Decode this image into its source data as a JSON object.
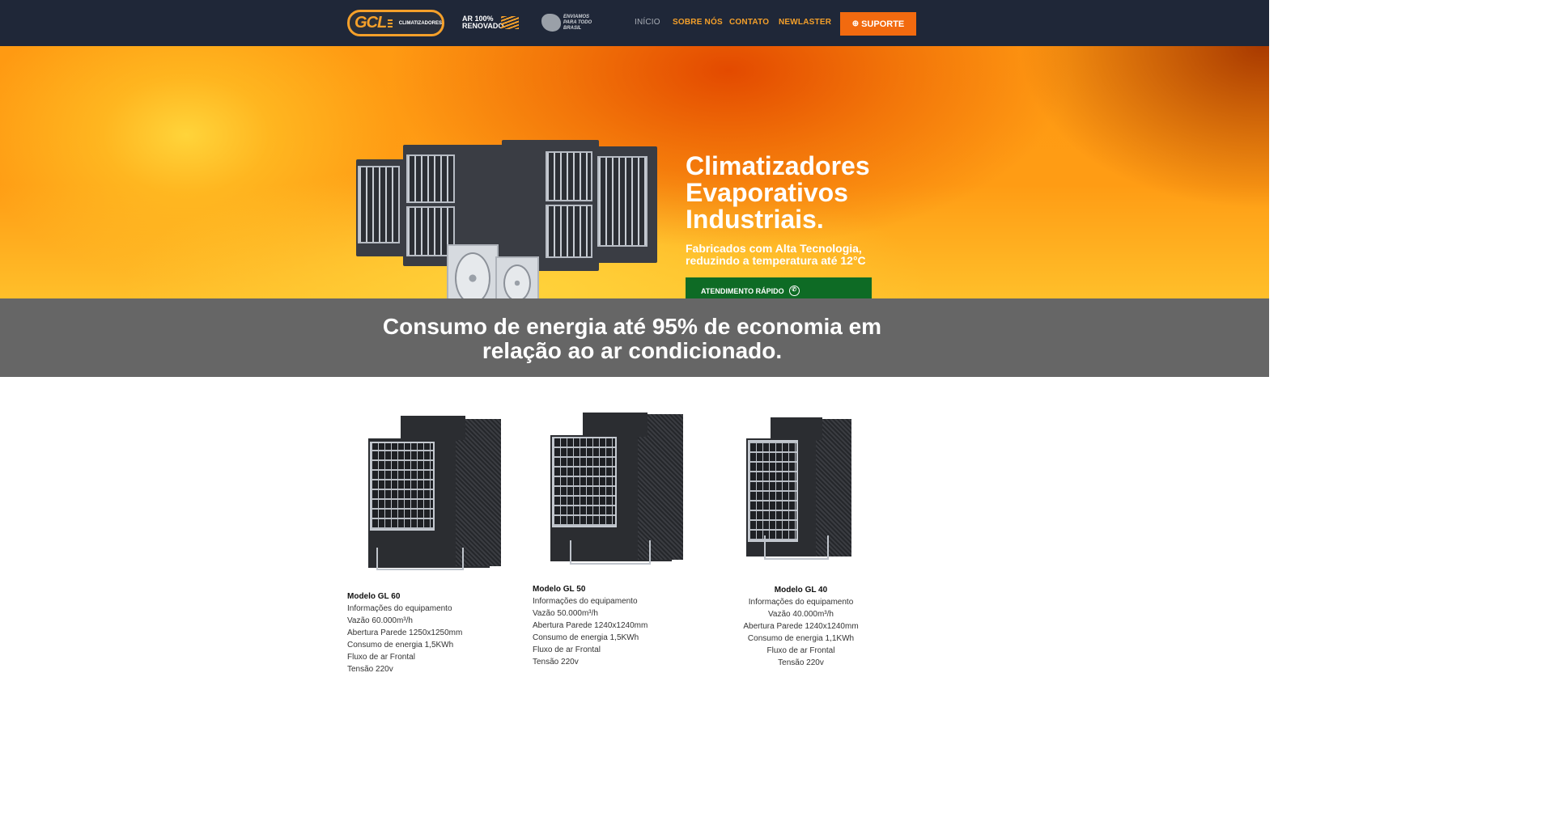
{
  "nav": {
    "logo_text": "GCL",
    "logo_sub": "CLIMATIZADORES",
    "badge_air": "AR 100% RENOVADO",
    "badge_br": "ENVIAMOS PARA TODO BRASIL",
    "menu": [
      "INÍCIO",
      "SOBRE NÓS",
      "CONTATO",
      "NEWLASTER"
    ],
    "support_label": "SUPORTE",
    "accent": "#f5a02a",
    "support_color": "#f26a0f"
  },
  "hero": {
    "title": "Climatizadores Evaporativos Industriais.",
    "subtitle": "Fabricados com Alta Tecnologia, reduzindo a temperatura até 12°C",
    "cta_label": "ATENDIMENTO RÁPIDO",
    "cta_color": "#0e6b25",
    "cta_icon": "whatsapp-icon"
  },
  "banner": {
    "text": "Consumo de energia até 95% de economia em relação ao ar condicionado."
  },
  "products": [
    {
      "model": "Modelo GL 60",
      "lines": [
        "Informações do equipamento",
        "Vazão 60.000m³/h",
        "Abertura Parede 1250x1250mm",
        "Consumo de energia 1,5KWh",
        "Fluxo de ar Frontal",
        "Tensão 220v"
      ]
    },
    {
      "model": "Modelo GL 50",
      "lines": [
        "Informações do equipamento",
        "Vazão 50.000m³/h",
        "Abertura Parede 1240x1240mm",
        "Consumo de energia 1,5KWh",
        "Fluxo de ar Frontal",
        "Tensão 220v"
      ]
    },
    {
      "model": "Modelo GL 40",
      "lines": [
        "Informações do equipamento",
        "Vazão 40.000m³/h",
        "Abertura Parede 1240x1240mm",
        "Consumo de energia 1,1KWh",
        "Fluxo de ar Frontal",
        "Tensão 220v"
      ]
    }
  ]
}
